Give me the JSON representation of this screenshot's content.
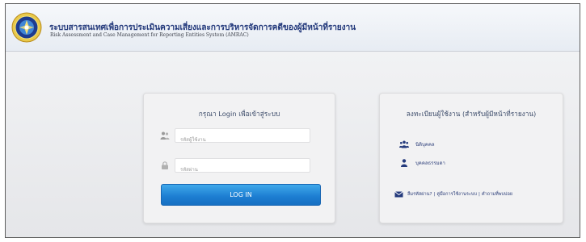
{
  "header": {
    "title_th": "ระบบสารสนเทศเพื่อการประเมินความเสี่ยงและการบริหารจัดการคดีของผู้มีหน้าที่รายงาน",
    "title_en": "Risk Assessment and Case Management for Reporting Entities System (AMRAC)",
    "logo_icon": "amrac-logo-icon"
  },
  "login": {
    "title": "กรุณา Login เพื่อเข้าสู่ระบบ",
    "username_placeholder": "รหัสผู้ใช้งาน",
    "username_icon": "user-group-icon",
    "password_placeholder": "รหัสผ่าน",
    "password_icon": "lock-icon",
    "button_label": "LOG IN"
  },
  "register": {
    "title": "ลงทะเบียนผู้ใช้งาน (สำหรับผู้มีหน้าที่รายงาน)",
    "person_label": "นิติบุคคล",
    "person_icon": "users-icon",
    "legal_label": "บุคคลธรรมดา",
    "legal_icon": "user-icon",
    "footer_icon": "envelope-icon",
    "footer_links": [
      "ลืมรหัสผ่าน?",
      "คู่มือการใช้งานระบบ",
      "คำถามที่พบบ่อย"
    ],
    "separator": "|"
  },
  "colors": {
    "accent": "#1c7dd1",
    "title": "#243a7c",
    "link": "#2d3f7a"
  }
}
